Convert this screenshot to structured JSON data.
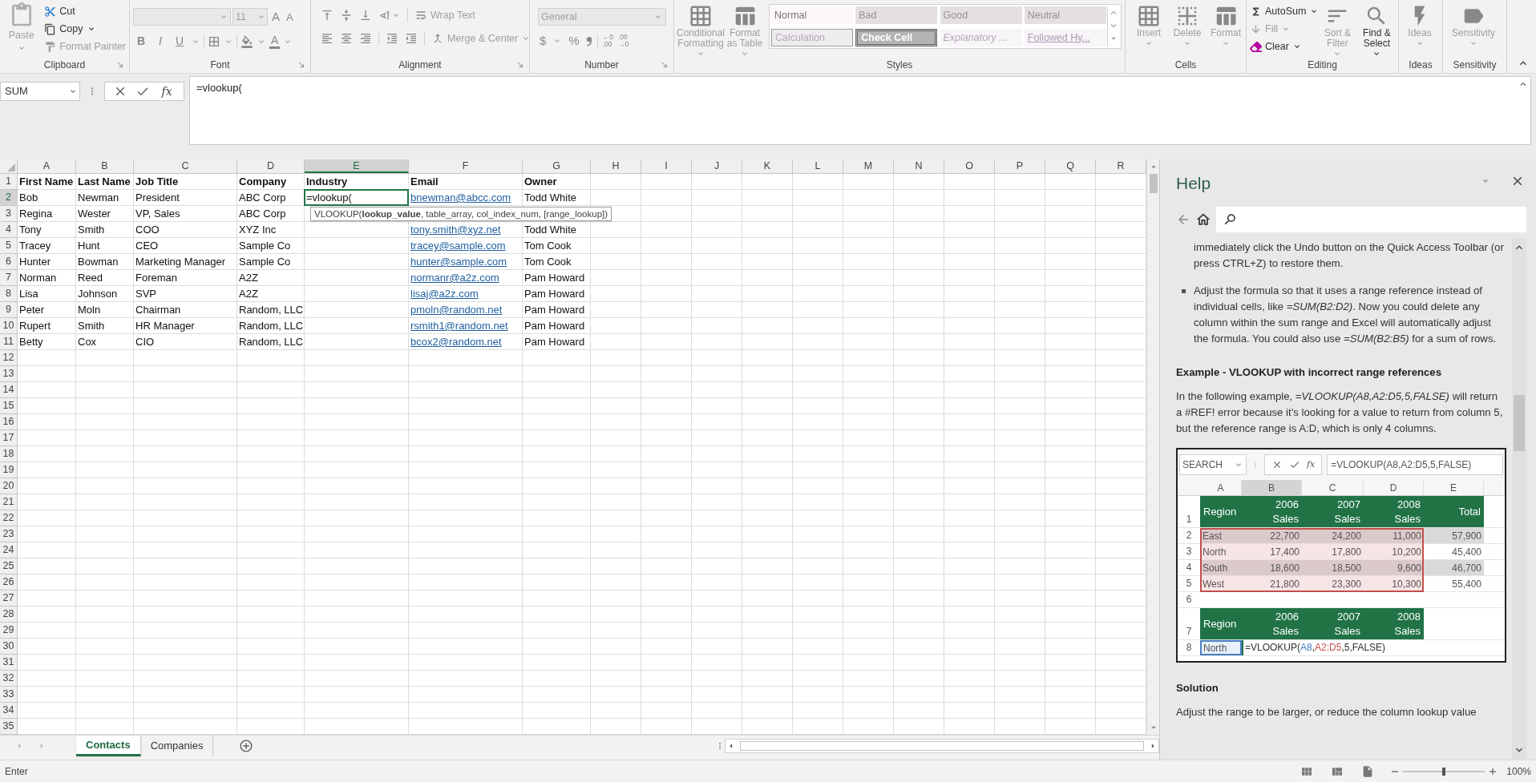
{
  "ribbon": {
    "clipboard": {
      "label": "Clipboard",
      "paste": {
        "label": "Paste",
        "disabled": true
      },
      "items": [
        {
          "kind": "cut",
          "label": "Cut",
          "disabled": false
        },
        {
          "kind": "copy",
          "label": "Copy",
          "disabled": false
        },
        {
          "kind": "painter",
          "label": "Format Painter",
          "disabled": true
        }
      ]
    },
    "font": {
      "label": "Font",
      "size": "11",
      "grow": "A",
      "shrink": "A",
      "buttons": [
        "B",
        "I",
        "U"
      ],
      "color_letter": "A"
    },
    "alignment": {
      "label": "Alignment",
      "wrap": "Wrap Text",
      "merge": "Merge & Center"
    },
    "number": {
      "label": "Number",
      "format": "General",
      "symbols": [
        "$",
        "%"
      ],
      "decimals": [
        {
          "top": "←0",
          "bottom": ".00"
        },
        {
          "top": ".00",
          "bottom": "→0"
        }
      ]
    },
    "styles": {
      "label": "Styles",
      "commands": [
        {
          "kind": "conditional",
          "label": "Conditional Formatting",
          "disabled": true
        },
        {
          "kind": "table",
          "label": "Format as Table",
          "disabled": true
        }
      ],
      "gallery": [
        {
          "kind": "normal",
          "label": "Normal"
        },
        {
          "kind": "bad",
          "label": "Bad"
        },
        {
          "kind": "good",
          "label": "Good"
        },
        {
          "kind": "neutral",
          "label": "Neutral"
        },
        {
          "kind": "calculation",
          "label": "Calculation"
        },
        {
          "kind": "check",
          "label": "Check Cell"
        },
        {
          "kind": "explanatory",
          "label": "Explanatory ..."
        },
        {
          "kind": "followed",
          "label": "Followed Hy..."
        }
      ]
    },
    "cells": {
      "label": "Cells",
      "commands": [
        {
          "kind": "insert",
          "label": "Insert",
          "disabled": true
        },
        {
          "kind": "delete",
          "label": "Delete",
          "disabled": true
        },
        {
          "kind": "format",
          "label": "Format",
          "disabled": true
        }
      ]
    },
    "editing": {
      "label": "Editing",
      "items": [
        {
          "kind": "autosum",
          "label": "AutoSum",
          "disabled": false
        },
        {
          "kind": "fill",
          "label": "Fill",
          "disabled": true
        },
        {
          "kind": "clear",
          "label": "Clear",
          "disabled": false
        }
      ],
      "commands": [
        {
          "kind": "sort",
          "label": "Sort & Filter",
          "disabled": true
        },
        {
          "kind": "find",
          "label": "Find & Select",
          "disabled": false
        }
      ]
    },
    "ideas": {
      "label": "Ideas",
      "command": {
        "kind": "ideas",
        "label": "Ideas",
        "disabled": true
      }
    },
    "sensitivity": {
      "label": "Sensitivity",
      "command": {
        "kind": "sensitivity",
        "label": "Sensitivity",
        "disabled": true
      }
    }
  },
  "formula_bar": {
    "name_box": "SUM",
    "function_label": "fx",
    "formula": "=vlookup("
  },
  "sheet": {
    "columns": [
      {
        "label": "A",
        "selected": false
      },
      {
        "label": "B",
        "selected": false
      },
      {
        "label": "C",
        "selected": false
      },
      {
        "label": "D",
        "selected": false
      },
      {
        "label": "E",
        "selected": true
      },
      {
        "label": "F",
        "selected": false
      },
      {
        "label": "G",
        "selected": false
      },
      {
        "label": "H",
        "selected": false
      },
      {
        "label": "I",
        "selected": false
      },
      {
        "label": "J",
        "selected": false
      },
      {
        "label": "K",
        "selected": false
      },
      {
        "label": "L",
        "selected": false
      },
      {
        "label": "M",
        "selected": false
      },
      {
        "label": "N",
        "selected": false
      },
      {
        "label": "O",
        "selected": false
      },
      {
        "label": "P",
        "selected": false
      },
      {
        "label": "Q",
        "selected": false
      },
      {
        "label": "R",
        "selected": false
      }
    ],
    "rows": [
      {
        "number": "1",
        "selected": false,
        "kind": "header",
        "cells": [
          "First Name",
          "Last Name",
          "Job Title",
          "Company",
          "Industry",
          "Email",
          "Owner"
        ]
      },
      {
        "number": "2",
        "selected": true,
        "kind": "data",
        "cells": [
          "Bob",
          "Newman",
          "President",
          "ABC Corp",
          "=vlookup(",
          {
            "link": "bnewman@abcc.com"
          },
          "Todd White"
        ]
      },
      {
        "number": "3",
        "selected": false,
        "kind": "data",
        "cells": [
          "Regina",
          "Wester",
          "VP, Sales",
          "ABC Corp"
        ]
      },
      {
        "number": "4",
        "selected": false,
        "kind": "data",
        "cells": [
          "Tony",
          "Smith",
          "COO",
          "XYZ Inc",
          "",
          {
            "link": "tony.smith@xyz.net"
          },
          "Todd White"
        ]
      },
      {
        "number": "5",
        "selected": false,
        "kind": "data",
        "cells": [
          "Tracey",
          "Hunt",
          "CEO",
          "Sample Co",
          "",
          {
            "link": "tracey@sample.com"
          },
          "Tom Cook"
        ]
      },
      {
        "number": "6",
        "selected": false,
        "kind": "data",
        "cells": [
          "Hunter",
          "Bowman",
          "Marketing Manager",
          "Sample Co",
          "",
          {
            "link": "hunter@sample.com"
          },
          "Tom Cook"
        ]
      },
      {
        "number": "7",
        "selected": false,
        "kind": "data",
        "cells": [
          "Norman",
          "Reed",
          "Foreman",
          "A2Z",
          "",
          {
            "link": "normanr@a2z.com"
          },
          "Pam Howard"
        ]
      },
      {
        "number": "8",
        "selected": false,
        "kind": "data",
        "cells": [
          "Lisa",
          "Johnson",
          "SVP",
          "A2Z",
          "",
          {
            "link": "lisaj@a2z.com"
          },
          "Pam Howard"
        ]
      },
      {
        "number": "9",
        "selected": false,
        "kind": "data",
        "cells": [
          "Peter",
          "Moln",
          "Chairman",
          "Random, LLC",
          "",
          {
            "link": "pmoln@random.net"
          },
          "Pam Howard"
        ]
      },
      {
        "number": "10",
        "selected": false,
        "kind": "data",
        "cells": [
          "Rupert",
          "Smith",
          "HR Manager",
          "Random, LLC",
          "",
          {
            "link": "rsmith1@random.net"
          },
          "Pam Howard"
        ]
      },
      {
        "number": "11",
        "selected": false,
        "kind": "data",
        "cells": [
          "Betty",
          "Cox",
          "CIO",
          "Random, LLC",
          "",
          {
            "link": "bcox2@random.net"
          },
          "Pam Howard"
        ]
      },
      {
        "number": "12",
        "selected": false,
        "kind": "data"
      },
      {
        "number": "13",
        "selected": false,
        "kind": "data"
      },
      {
        "number": "14",
        "selected": false,
        "kind": "data"
      },
      {
        "number": "15",
        "selected": false,
        "kind": "data"
      },
      {
        "number": "16",
        "selected": false,
        "kind": "data"
      },
      {
        "number": "17",
        "selected": false,
        "kind": "data"
      },
      {
        "number": "18",
        "selected": false,
        "kind": "data"
      },
      {
        "number": "19",
        "selected": false,
        "kind": "data"
      },
      {
        "number": "20",
        "selected": false,
        "kind": "data"
      },
      {
        "number": "21",
        "selected": false,
        "kind": "data"
      },
      {
        "number": "22",
        "selected": false,
        "kind": "data"
      },
      {
        "number": "23",
        "selected": false,
        "kind": "data"
      },
      {
        "number": "24",
        "selected": false,
        "kind": "data"
      },
      {
        "number": "25",
        "selected": false,
        "kind": "data"
      },
      {
        "number": "26",
        "selected": false,
        "kind": "data"
      },
      {
        "number": "27",
        "selected": false,
        "kind": "data"
      },
      {
        "number": "28",
        "selected": false,
        "kind": "data"
      },
      {
        "number": "29",
        "selected": false,
        "kind": "data"
      },
      {
        "number": "30",
        "selected": false,
        "kind": "data"
      },
      {
        "number": "31",
        "selected": false,
        "kind": "data"
      },
      {
        "number": "32",
        "selected": false,
        "kind": "data"
      },
      {
        "number": "33",
        "selected": false,
        "kind": "data"
      },
      {
        "number": "34",
        "selected": false,
        "kind": "data"
      },
      {
        "number": "35",
        "selected": false,
        "kind": "data"
      }
    ],
    "tooltip": "VLOOKUP(**lookup_value**, table_array, col_index_num, [range_lookup])"
  },
  "sheet_tabs": [
    {
      "label": "Contacts",
      "selected": true
    },
    {
      "label": "Companies",
      "selected": false
    }
  ],
  "status_bar": {
    "mode": "Enter",
    "zoom": "100%",
    "zoom_slider": {
      "level": 0.5
    }
  },
  "help": {
    "title": "Help",
    "blocks": [
      {
        "kind": "indented",
        "text": "immediately click the Undo button on the Quick Access Toolbar (or press CTRL+Z) to restore them."
      },
      {
        "kind": "bullet",
        "text": "Adjust the formula so that it uses a range reference instead of individual cells, like *=SUM(B2:D2)*. Now you could delete any column within the sum range and Excel will automatically adjust the formula. You could also use *=SUM(B2:B5)* for a sum of rows."
      },
      {
        "kind": "heading",
        "text": "Example - VLOOKUP with incorrect range references"
      },
      {
        "kind": "paragraph",
        "text": "In the following example, *=VLOOKUP(A8,A2:D5,5,FALSE)* will return a #REF! error because it’s looking for a value to return from column 5, but the reference range is A:D, which is only 4 columns."
      },
      {
        "kind": "example",
        "name_box": "SEARCH",
        "function_label": "fx",
        "formula": "=VLOOKUP(A8,A2:D5,5,FALSE)",
        "columns": [
          {
            "label": "A",
            "selected": false
          },
          {
            "label": "B",
            "selected": true
          },
          {
            "label": "C",
            "selected": false
          },
          {
            "label": "D",
            "selected": false
          },
          {
            "label": "E",
            "selected": false
          }
        ],
        "rows": [
          {
            "number": "1",
            "kind": "header",
            "cells": [
              "Region",
              "2006 Sales",
              "2007 Sales",
              "2008 Sales",
              "Total"
            ]
          },
          {
            "number": "2",
            "kind": "data",
            "cells": [
              "East",
              "22,700",
              "24,200",
              "11,000",
              "57,900"
            ]
          },
          {
            "number": "3",
            "kind": "data",
            "cells": [
              "North",
              "17,400",
              "17,800",
              "10,200",
              "45,400"
            ]
          },
          {
            "number": "4",
            "kind": "data",
            "cells": [
              "South",
              "18,600",
              "18,500",
              "9,600",
              "46,700"
            ]
          },
          {
            "number": "5",
            "kind": "data",
            "cells": [
              "West",
              "21,800",
              "23,300",
              "10,300",
              "55,400"
            ]
          },
          {
            "number": "6",
            "kind": "blank"
          },
          {
            "number": "7",
            "kind": "header",
            "cells": [
              "Region",
              "2006 Sales",
              "2007 Sales",
              "2008 Sales"
            ]
          },
          {
            "number": "8",
            "kind": "formula",
            "cells": [
              "North"
            ],
            "formula_parts": [
              {
                "text": "=VLOOKUP("
              },
              {
                "text": "A8",
                "color": "#4a7fc1"
              },
              {
                "text": ","
              },
              {
                "text": "A2:D5",
                "color": "#c0504d"
              },
              {
                "text": ",5,FALSE)"
              }
            ]
          }
        ]
      },
      {
        "kind": "heading",
        "text": "Solution"
      },
      {
        "kind": "paragraph",
        "text": "Adjust the range to be larger, or reduce the column lookup value"
      }
    ]
  }
}
